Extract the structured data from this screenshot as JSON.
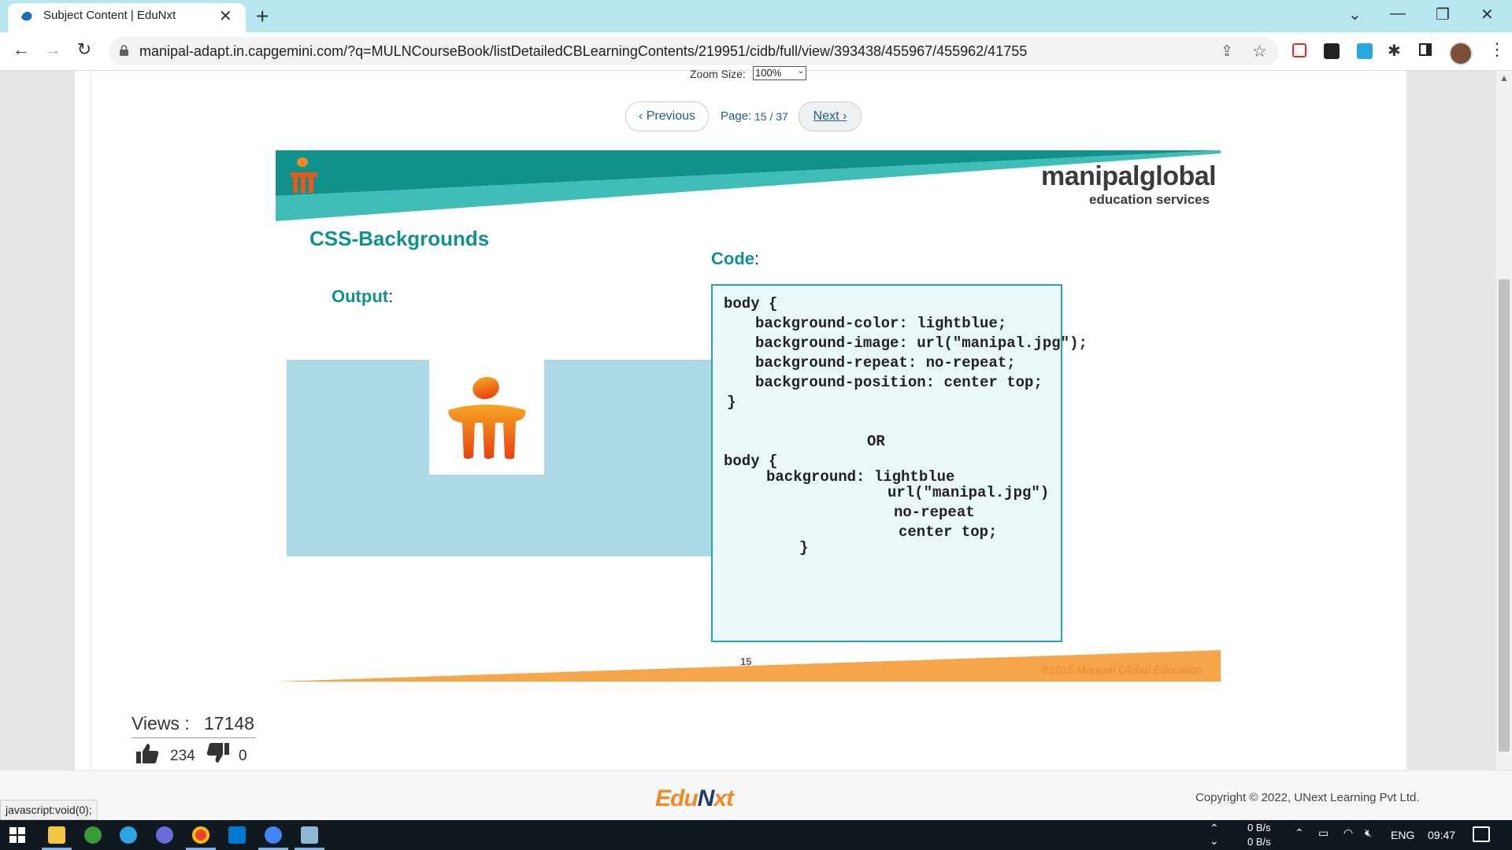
{
  "browser": {
    "tab_title": "Subject Content | EduNxt",
    "tab_close": "✕",
    "new_tab": "+",
    "url": "manipal-adapt.in.capgemini.com/?q=MULNCourseBook/listDetailedCBLearningContents/219951/cidb/full/view/393438/455967/455962/41755",
    "win_controls": [
      "⌄",
      "—",
      "❐",
      "✕"
    ]
  },
  "viewer": {
    "zoom_label": "Zoom Size:",
    "zoom_value": "100%",
    "prev_label": "‹ Previous",
    "page_label": "Page:",
    "page_number": "15 / 37",
    "next_label": "Next ›"
  },
  "slide": {
    "brand_main": "manipalglobal",
    "brand_sub": "education services",
    "title": "CSS-Backgrounds",
    "code_heading": "Code",
    "output_heading": "Output",
    "code_lines": [
      "body {",
      "background-color: lightblue;",
      "background-image: url(\"manipal.jpg\");",
      "background-repeat: no-repeat;",
      "background-position: center top;",
      "}",
      "OR",
      "body {",
      "background: lightblue",
      "url(\"manipal.jpg\")",
      "no-repeat",
      "center top;",
      "}"
    ],
    "slide_number": "15",
    "copyright": "©2015 Manipal Global Education",
    "colors": {
      "teal": "#10918c",
      "teal_light": "#3fbdb6",
      "orange": "#f7a54a",
      "output_bg": "#add8e6"
    }
  },
  "stats": {
    "views_label": "Views :",
    "views_value": "17148",
    "likes": "234",
    "dislikes": "0"
  },
  "footer": {
    "logo_part1": "Edu",
    "logo_part2": "N",
    "logo_part3": "xt",
    "copyright": "Copyright © 2022, UNext Learning Pvt Ltd.",
    "status_url": "javascript:void(0);"
  },
  "taskbar": {
    "net_up": "0 B/s",
    "net_down": "0 B/s",
    "lang": "ENG",
    "time": "09:47"
  }
}
